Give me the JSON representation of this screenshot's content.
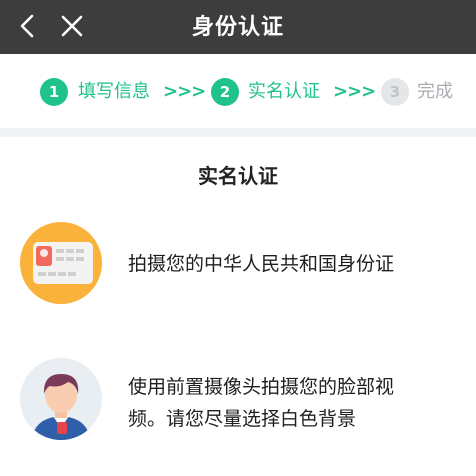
{
  "header": {
    "title": "身份认证",
    "back_icon": "chevron-left-icon",
    "close_icon": "close-icon",
    "background": "#3d3d3d"
  },
  "steps": [
    {
      "number": "1",
      "label": "填写信息",
      "state": "done"
    },
    {
      "number": "2",
      "label": "实名认证",
      "state": "current"
    },
    {
      "number": "3",
      "label": "完成",
      "state": "pending"
    }
  ],
  "step_separator": ">>>",
  "accent_color": "#1fc28c",
  "section": {
    "title": "实名认证"
  },
  "methods": [
    {
      "icon": "id-card-icon",
      "text": "拍摄您的中华人民共和国身份证"
    },
    {
      "icon": "person-avatar-icon",
      "text_line1": "使用前置摄像头拍摄您的脸部视",
      "text_line2": "频。请您尽量选择白色背景"
    }
  ]
}
